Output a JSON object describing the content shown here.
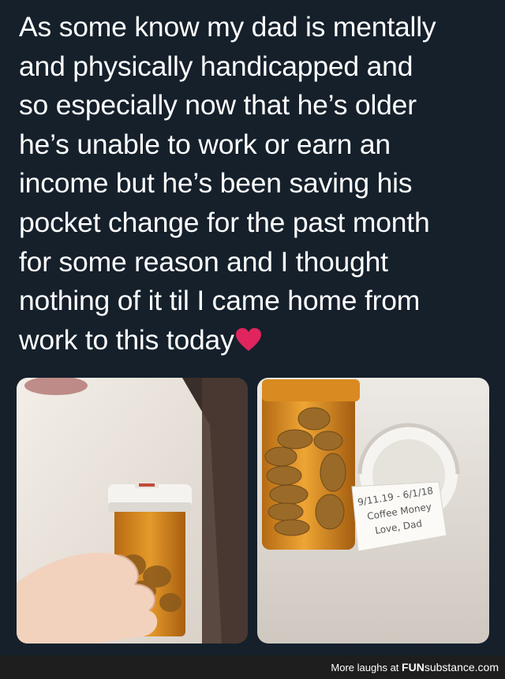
{
  "tweet": {
    "lines": [
      "As some know my dad is mentally",
      "and physically handicapped and",
      "so especially now that he’s older",
      "he’s unable to work or earn an",
      "income but he’s been saving his",
      "pocket change for the past month",
      "for some reason and I thought",
      "nothing of it til I came home from",
      "work to this today"
    ],
    "emoji": "red-heart-icon"
  },
  "photos": {
    "note_text": [
      "9/11.19 - 6/1/18",
      "Coffee Money",
      "Love, Dad"
    ]
  },
  "footer": {
    "prefix": "More laughs at",
    "brand_bold": "FUN",
    "brand_rest": "substance.com"
  },
  "colors": {
    "background": "#15202b",
    "text": "#ffffff",
    "heart": "#e0245e",
    "footer_bar": "#1e1e1e"
  }
}
